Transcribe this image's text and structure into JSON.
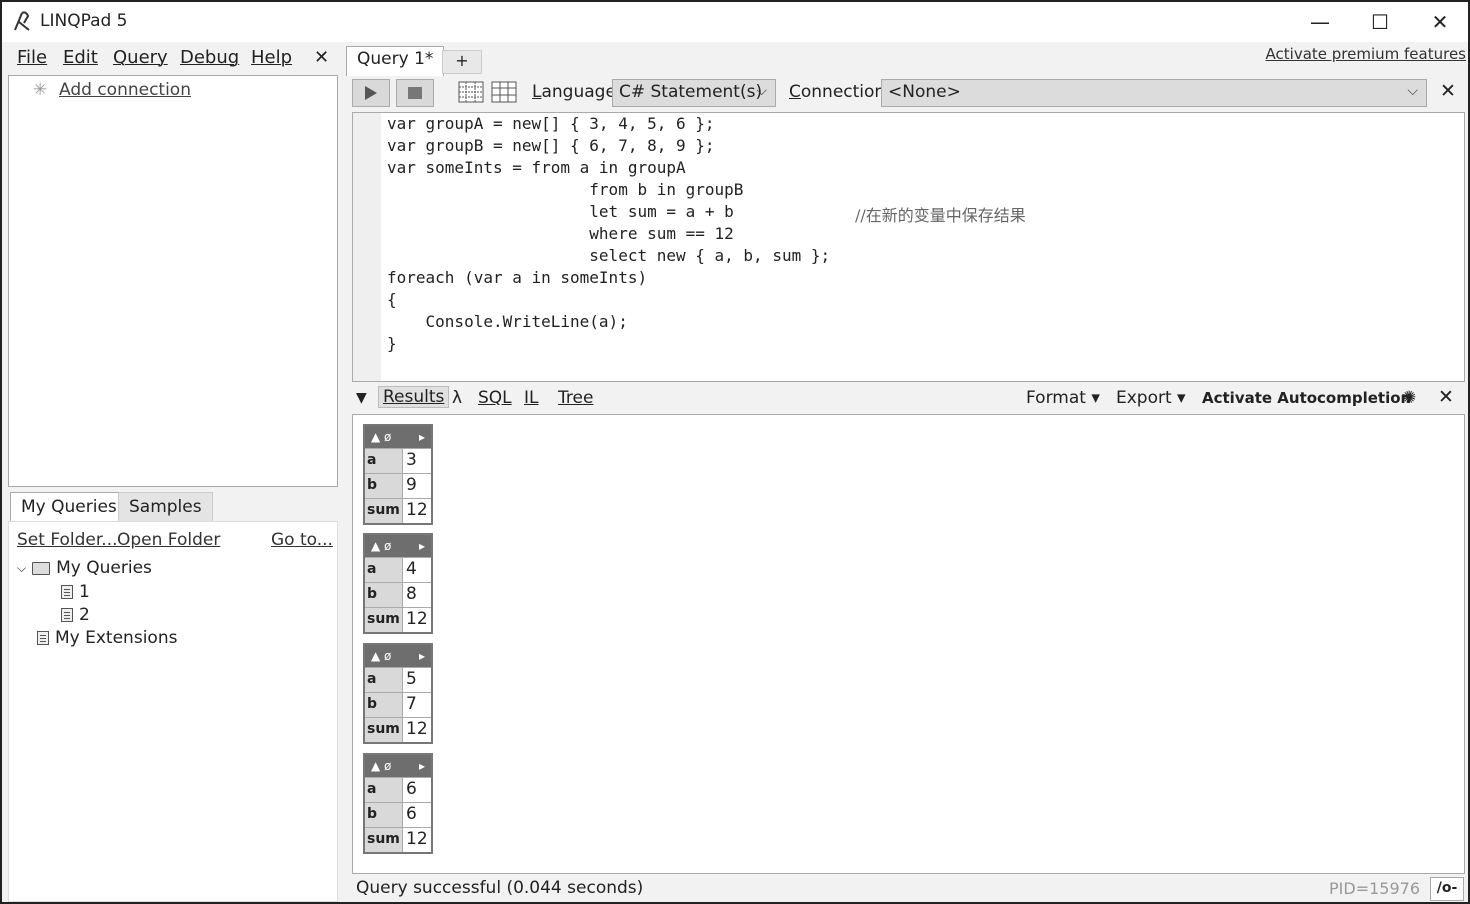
{
  "window": {
    "title": "LINQPad 5",
    "minimize": "—",
    "maximize": "☐",
    "close": "✕"
  },
  "menu": {
    "items": [
      "File",
      "Edit",
      "Query",
      "Debug",
      "Help"
    ],
    "close": "✕"
  },
  "connections": {
    "add_label": "Add connection"
  },
  "queries_panel": {
    "tabs": [
      "My Queries",
      "Samples"
    ],
    "set_folder": "Set Folder...",
    "open_folder": "Open Folder",
    "go_to": "Go to...",
    "tree": {
      "root": "My Queries",
      "children": [
        "1",
        "2"
      ],
      "extensions": "My Extensions"
    }
  },
  "editor_tabs": {
    "active": "Query 1*",
    "add": "+",
    "premium": "Activate premium features"
  },
  "toolbar": {
    "language_label": "Language",
    "language_value": "C# Statement(s)",
    "connection_label": "Connection",
    "connection_value": "<None>",
    "close": "✕"
  },
  "code": {
    "lines": [
      "var groupA = new[] { 3, 4, 5, 6 };",
      "var groupB = new[] { 6, 7, 8, 9 };",
      "var someInts = from a in groupA",
      "                     from b in groupB",
      "                     let sum = a + b",
      "                     where sum == 12",
      "                     select new { a, b, sum };",
      "foreach (var a in someInts)",
      "{",
      "    Console.WriteLine(a);",
      "}"
    ],
    "comment": "//在新的变量中保存结果"
  },
  "results_bar": {
    "results": "Results",
    "lambda": "λ",
    "sql": "SQL",
    "il": "IL",
    "tree": "Tree",
    "format": "Format",
    "export": "Export",
    "autocompletion": "Activate Autocompletion",
    "close": "✕"
  },
  "results": {
    "header_left": "▲ ø",
    "header_right": "▸",
    "key_labels": [
      "a",
      "b",
      "sum"
    ],
    "rows": [
      {
        "a": "3",
        "b": "9",
        "sum": "12"
      },
      {
        "a": "4",
        "b": "8",
        "sum": "12"
      },
      {
        "a": "5",
        "b": "7",
        "sum": "12"
      },
      {
        "a": "6",
        "b": "6",
        "sum": "12"
      }
    ]
  },
  "status": {
    "text": "Query successful  (0.044 seconds)",
    "pid": "PID=15976",
    "io": "/o-"
  }
}
